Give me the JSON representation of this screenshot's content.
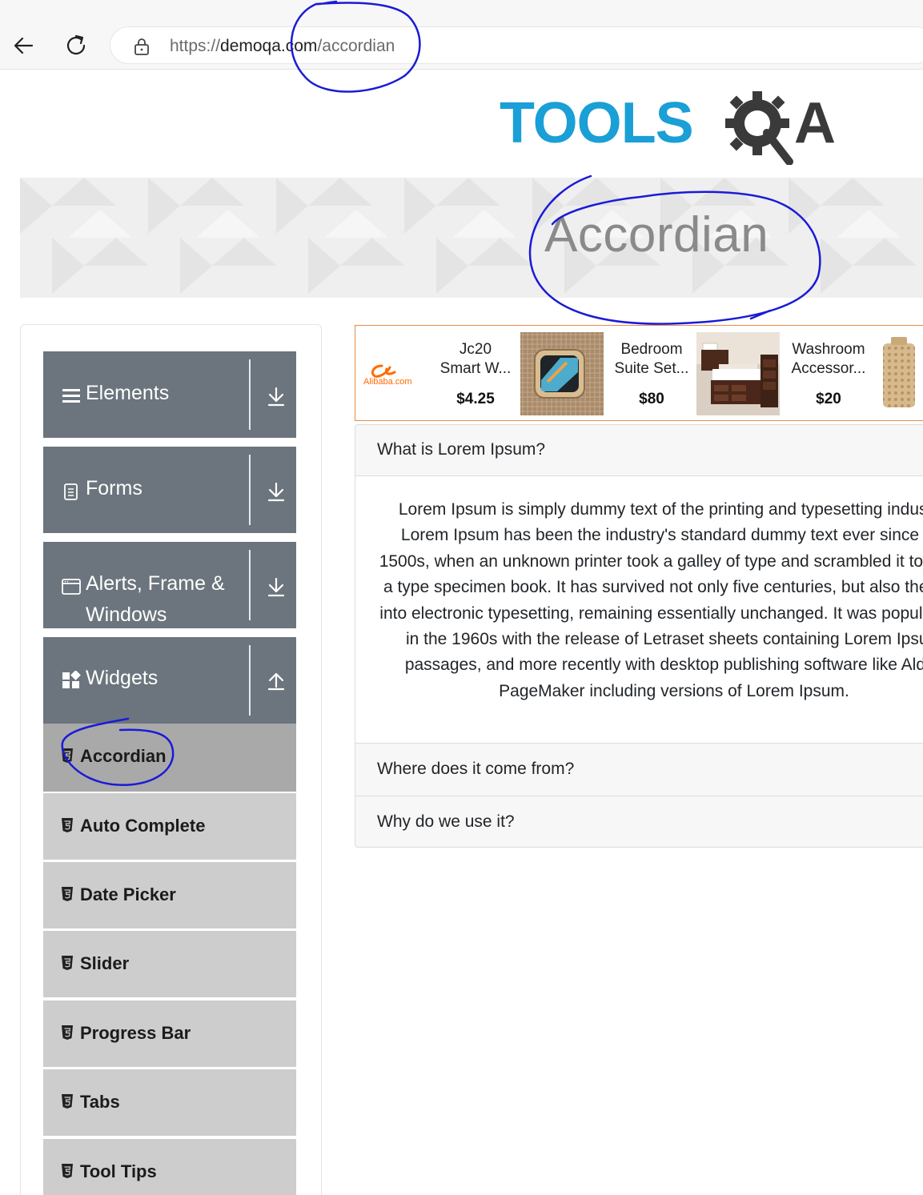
{
  "browser": {
    "url_prefix": "https://",
    "url_domain": "demoqa.com",
    "url_path": "/accordian"
  },
  "logo": {
    "part1": "TOOLS",
    "part2": "A"
  },
  "page": {
    "title": "Accordian"
  },
  "sidebar": {
    "groups": [
      {
        "label": "Elements",
        "icon": "hamburger-icon"
      },
      {
        "label": "Forms",
        "icon": "document-icon"
      },
      {
        "label_line1": "Alerts, Frame &",
        "label_line2": "Windows",
        "icon": "window-icon"
      },
      {
        "label": "Widgets",
        "icon": "widgets-icon"
      }
    ],
    "widget_items": [
      {
        "label": "Accordian",
        "active": true
      },
      {
        "label": "Auto Complete"
      },
      {
        "label": "Date Picker"
      },
      {
        "label": "Slider"
      },
      {
        "label": "Progress Bar"
      },
      {
        "label": "Tabs"
      },
      {
        "label": "Tool Tips"
      }
    ]
  },
  "ad": {
    "brand": "Alibaba.com",
    "products": [
      {
        "name_line1": "Jc20",
        "name_line2": "Smart W...",
        "price": "$4.25"
      },
      {
        "name_line1": "Bedroom",
        "name_line2": "Suite Set...",
        "price": "$80"
      },
      {
        "name_line1": "Washroom",
        "name_line2": "Accessor...",
        "price": "$20"
      }
    ]
  },
  "accordion": {
    "sections": [
      {
        "title": "What is Lorem Ipsum?",
        "body": "Lorem Ipsum is simply dummy text of the printing and typesetting industry. Lorem Ipsum has been the industry's standard dummy text ever since the 1500s, when an unknown printer took a galley of type and scrambled it to make a type specimen book. It has survived not only five centuries, but also the leap into electronic typesetting, remaining essentially unchanged. It was popularised in the 1960s with the release of Letraset sheets containing Lorem Ipsum passages, and more recently with desktop publishing software like Aldus PageMaker including versions of Lorem Ipsum."
      },
      {
        "title": "Where does it come from?"
      },
      {
        "title": "Why do we use it?"
      }
    ]
  },
  "colors": {
    "sidebar_header": "#6c757d",
    "sidebar_item": "#cdcdcd",
    "sidebar_item_active": "#a9a9a9",
    "logo_blue": "#1a9fd6",
    "logo_dark": "#3a3a3a",
    "ad_border": "#e88b44",
    "annotation_ink": "#1a1ad8"
  }
}
